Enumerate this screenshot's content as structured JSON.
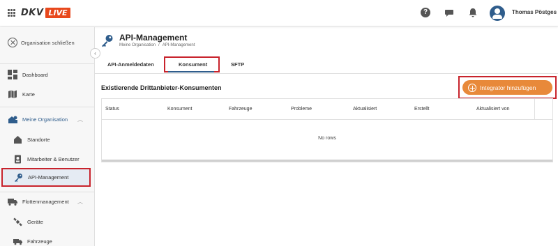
{
  "header": {
    "logo_primary": "DKV",
    "logo_secondary": "LIVE",
    "help_glyph": "?",
    "user_name": "Thomas Pöstges",
    "icons": [
      "apps-grid-icon",
      "help-icon",
      "chat-icon",
      "bell-icon",
      "user-avatar-icon"
    ]
  },
  "sidebar": {
    "close_org_label": "Organisation schließen",
    "collapse_glyph": "‹",
    "items": [
      {
        "label": "Dashboard",
        "icon": "dashboard-icon"
      },
      {
        "label": "Karte",
        "icon": "map-icon"
      },
      {
        "label": "Meine Organisation",
        "icon": "organisation-icon",
        "expanded": true
      },
      {
        "label": "Standorte",
        "icon": "house-icon"
      },
      {
        "label": "Mitarbeiter & Benutzer",
        "icon": "badge-icon"
      },
      {
        "label": "API-Management",
        "icon": "key-icon",
        "active": true
      },
      {
        "label": "Flottenmanagement",
        "icon": "truck-icon",
        "expanded": true
      },
      {
        "label": "Geräte",
        "icon": "satellite-icon"
      },
      {
        "label": "Fahrzeuge",
        "icon": "vehicle-icon"
      }
    ],
    "chevron_glyph": "︿"
  },
  "page": {
    "title": "API-Management",
    "breadcrumb": [
      "Meine Organisation",
      "/",
      "API-Management"
    ]
  },
  "tabs": [
    {
      "label": "API-Anmeldedaten"
    },
    {
      "label": "Konsument",
      "active": true
    },
    {
      "label": "SFTP"
    }
  ],
  "consumers": {
    "section_title": "Existierende Drittanbieter-Konsumenten",
    "add_button_label": "Integrator hinzufügen",
    "columns": [
      "Status",
      "Konsument",
      "Fahrzeuge",
      "Probleme",
      "Aktualisiert",
      "Erstellt",
      "Aktualisiert von"
    ],
    "empty_text": "No rows"
  },
  "colors": {
    "accent": "#2f5d8c",
    "brand_red": "#e8481c",
    "button_orange": "#e8893a",
    "highlight_red": "#c8232c"
  }
}
